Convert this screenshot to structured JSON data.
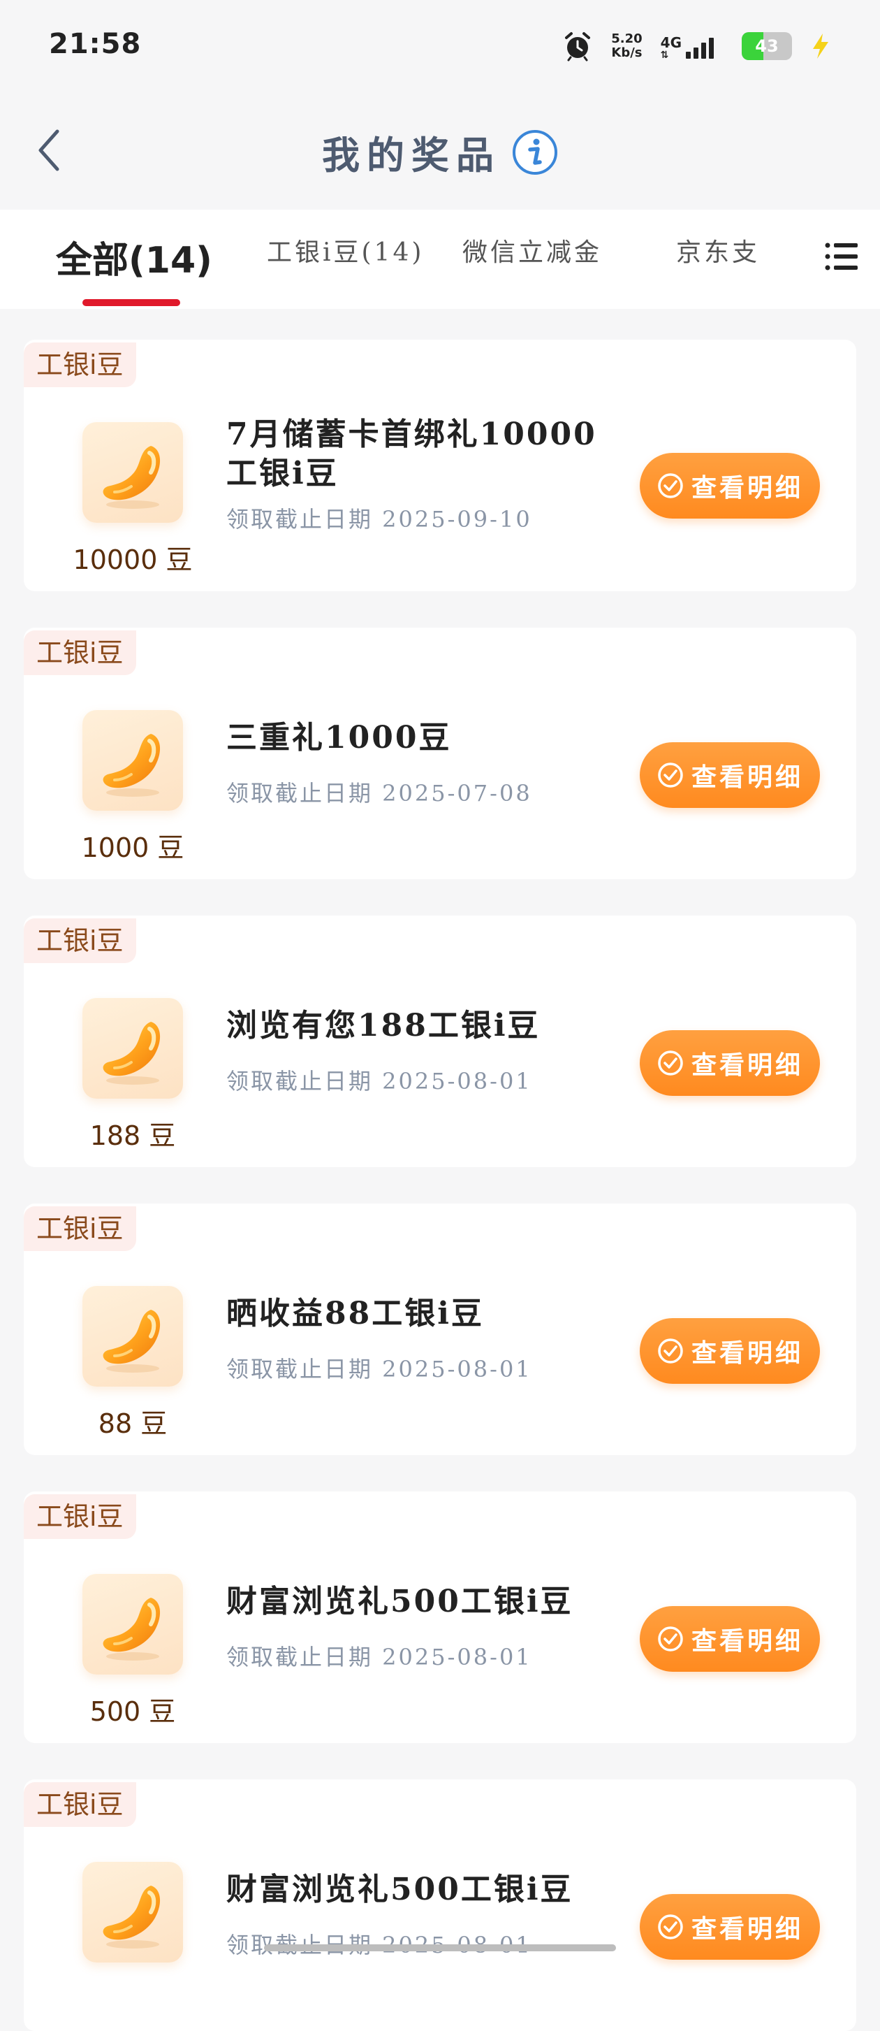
{
  "status_bar": {
    "time": "21:58",
    "net_speed_value": "5.20",
    "net_speed_unit": "Kb/s",
    "net_type": "4G",
    "battery": "43",
    "battery_level_percent": 43,
    "icons": [
      "alarm-icon",
      "signal-icon",
      "battery-icon",
      "charging-icon"
    ]
  },
  "header": {
    "title": "我的奖品",
    "icons": [
      "back-icon",
      "info-icon"
    ]
  },
  "tabs": {
    "items": [
      "全部(14)",
      "工银i豆(14)",
      "微信立减金",
      "京东支"
    ],
    "active_index": 0,
    "accent_color": "#e0192b"
  },
  "colors": {
    "button": "#ff8a1f",
    "tag_bg": "#fdeeec",
    "tag_text": "#8a4a1c"
  },
  "prizes": [
    {
      "tag": "工银i豆",
      "title": "7月储蓄卡首绑礼10000工银i豆",
      "deadline": "领取截止日期 2025-09-10",
      "amount": "10000 豆",
      "button": "查看明细"
    },
    {
      "tag": "工银i豆",
      "title": "三重礼1000豆",
      "deadline": "领取截止日期 2025-07-08",
      "amount": "1000 豆",
      "button": "查看明细"
    },
    {
      "tag": "工银i豆",
      "title": "浏览有您188工银i豆",
      "deadline": "领取截止日期 2025-08-01",
      "amount": "188 豆",
      "button": "查看明细"
    },
    {
      "tag": "工银i豆",
      "title": "晒收益88工银i豆",
      "deadline": "领取截止日期 2025-08-01",
      "amount": "88 豆",
      "button": "查看明细"
    },
    {
      "tag": "工银i豆",
      "title": "财富浏览礼500工银i豆",
      "deadline": "领取截止日期 2025-08-01",
      "amount": "500 豆",
      "button": "查看明细"
    },
    {
      "tag": "工银i豆",
      "title": "财富浏览礼500工银i豆",
      "deadline": "领取截止日期 2025-08-01",
      "amount": "",
      "button": "查看明细"
    }
  ]
}
